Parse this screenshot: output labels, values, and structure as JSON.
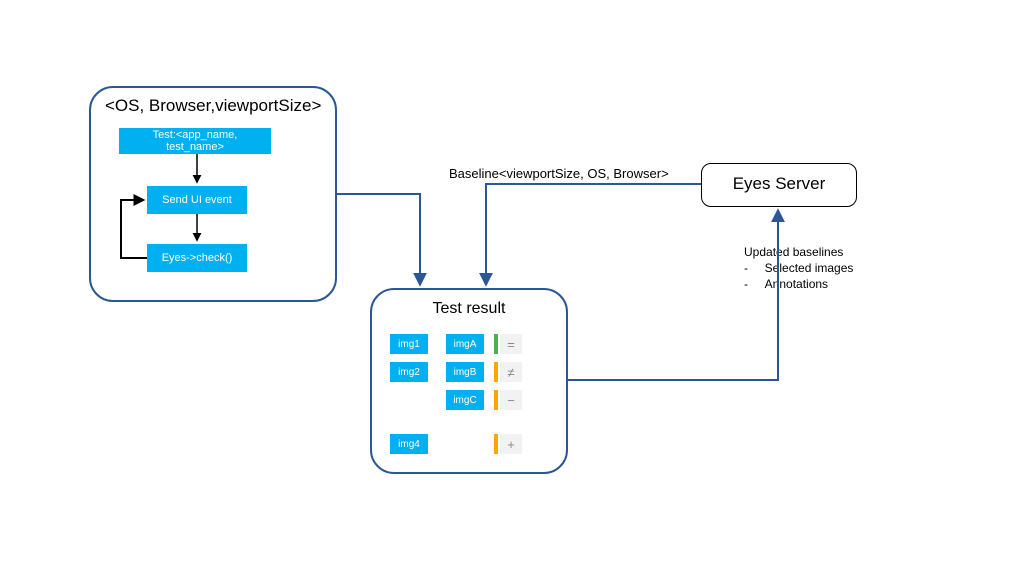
{
  "colors": {
    "panel_border": "#2b5797",
    "box_fill": "#00b0f0",
    "status_green": "#4caf50",
    "status_orange": "#ffa500"
  },
  "test_panel": {
    "title": "<OS, Browser,viewportSize>",
    "test_box": "Test:<app_name, test_name>",
    "step1": "Send UI event",
    "step2": "Eyes->check()"
  },
  "baseline_label": "Baseline<viewportSize, OS, Browser>",
  "server_panel": {
    "title": "Eyes Server"
  },
  "notes": {
    "heading": "Updated baselines",
    "bullet1": "Selected images",
    "bullet2": "Annotations"
  },
  "result_panel": {
    "title": "Test result",
    "left": [
      "img1",
      "img2",
      "",
      "img4"
    ],
    "right": [
      "imgA",
      "imgB",
      "imgC"
    ],
    "statuses": [
      {
        "color": "#4caf50",
        "sym": "="
      },
      {
        "color": "#ffa500",
        "sym": "≠"
      },
      {
        "color": "#ffa500",
        "sym": "−"
      },
      {
        "color": "#ffa500",
        "sym": "+"
      }
    ]
  }
}
